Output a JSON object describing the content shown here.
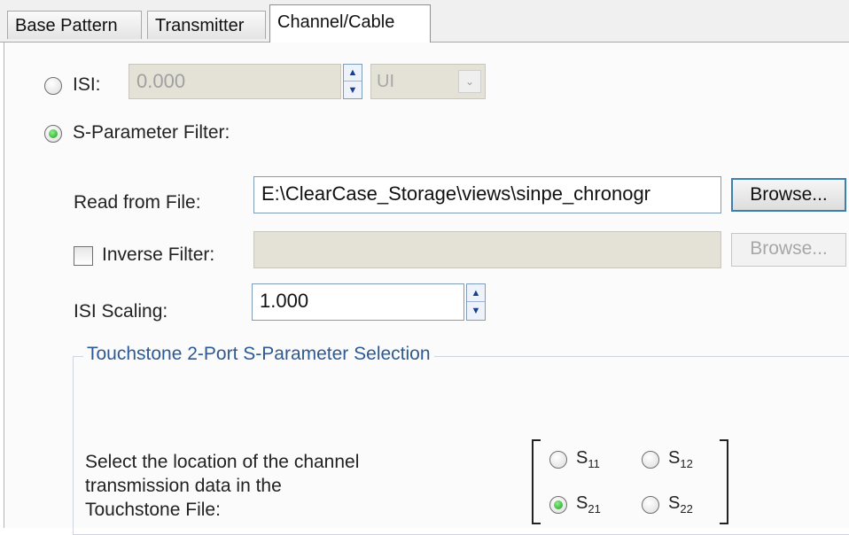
{
  "tabs": [
    {
      "label": "Base Pattern"
    },
    {
      "label": "Transmitter"
    },
    {
      "label": "Channel/Cable"
    }
  ],
  "isi": {
    "label": "ISI:",
    "value": "0.000",
    "unit": "UI"
  },
  "sparam_filter": {
    "label": "S-Parameter Filter:"
  },
  "read_file": {
    "label": "Read from File:",
    "path": "E:\\ClearCase_Storage\\views\\sinpe_chronogr",
    "browse": "Browse..."
  },
  "inverse": {
    "label": "Inverse Filter:",
    "value": "",
    "browse": "Browse..."
  },
  "isi_scaling": {
    "label": "ISI Scaling:",
    "value": "1.000"
  },
  "touchstone": {
    "title": "Touchstone 2-Port S-Parameter Selection",
    "instructions": [
      "Select the location of the channel",
      "transmission data in the",
      "Touchstone File:"
    ],
    "options": [
      {
        "base": "S",
        "sub": "11"
      },
      {
        "base": "S",
        "sub": "12"
      },
      {
        "base": "S",
        "sub": "21"
      },
      {
        "base": "S",
        "sub": "22"
      }
    ]
  },
  "colors": {
    "accent": "#3c7fb1",
    "group_title": "#2e5a94",
    "radio_selected": "#1a9c1a",
    "disabled_field": "#e4e1d6"
  }
}
